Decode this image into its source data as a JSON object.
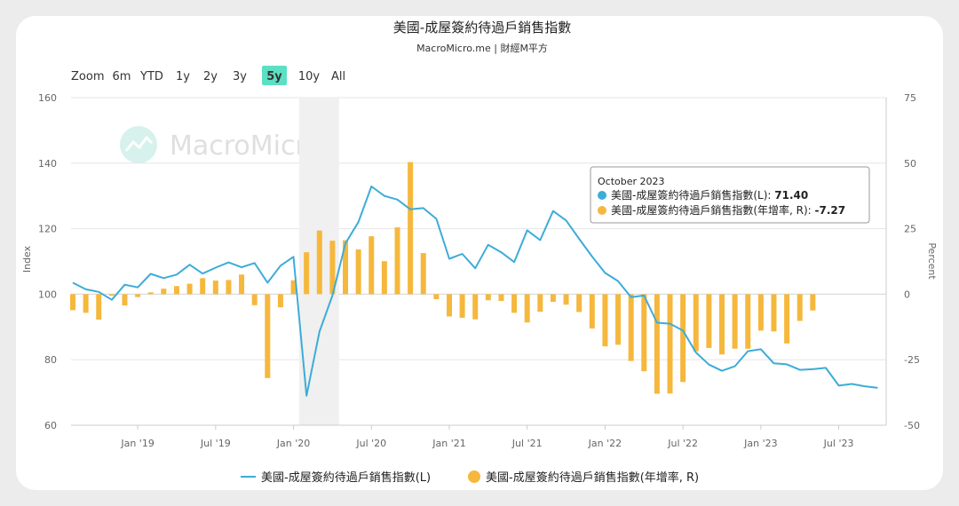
{
  "header": {
    "title": "美國-成屋簽約待過戶銷售指數",
    "subtitle": "MacroMicro.me | 財經M平方"
  },
  "zoom": {
    "label": "Zoom",
    "buttons": [
      "6m",
      "YTD",
      "1y",
      "2y",
      "3y",
      "5y",
      "10y",
      "All"
    ],
    "active": "5y"
  },
  "watermark": "MacroMicro",
  "legend": {
    "line_label": "美國-成屋簽約待過戶銷售指數(L)",
    "bar_label": "美國-成屋簽約待過戶銷售指數(年增率, R)"
  },
  "tooltip": {
    "date": "October 2023",
    "row1_label": "美國-成屋簽約待過戶銷售指數(L): ",
    "row1_value": "71.40",
    "row2_label": "美國-成屋簽約待過戶銷售指數(年增率, R): ",
    "row2_value": "-7.27"
  },
  "colors": {
    "line": "#3dacd8",
    "bar": "#f5b83d",
    "shade": "#f0f0f0",
    "active_button": "#5be0c4"
  },
  "chart_data": {
    "type": "line",
    "title": "美國-成屋簽約待過戶銷售指數",
    "subtitle": "MacroMicro.me | 財經M平方",
    "ylabel_left": "Index",
    "ylabel_right": "Percent",
    "y_left_range": [
      60,
      160
    ],
    "y_left_ticks": [
      60,
      80,
      100,
      120,
      140,
      160
    ],
    "y_right_range": [
      -50,
      75
    ],
    "y_right_ticks": [
      -50,
      -25,
      0,
      25,
      50,
      75
    ],
    "x_tick_labels": [
      "Jan '19",
      "Jul '19",
      "Jan '20",
      "Jul '20",
      "Jan '21",
      "Jul '21",
      "Jan '22",
      "Jul '22",
      "Jan '23",
      "Jul '23"
    ],
    "shaded_range": [
      "2020-02",
      "2020-04"
    ],
    "grid": true,
    "legend_position": "bottom",
    "months": [
      "2018-08",
      "2018-09",
      "2018-10",
      "2018-11",
      "2018-12",
      "2019-01",
      "2019-02",
      "2019-03",
      "2019-04",
      "2019-05",
      "2019-06",
      "2019-07",
      "2019-08",
      "2019-09",
      "2019-10",
      "2019-11",
      "2019-12",
      "2020-01",
      "2020-02",
      "2020-03",
      "2020-04",
      "2020-05",
      "2020-06",
      "2020-07",
      "2020-08",
      "2020-09",
      "2020-10",
      "2020-11",
      "2020-12",
      "2021-01",
      "2021-02",
      "2021-03",
      "2021-04",
      "2021-05",
      "2021-06",
      "2021-07",
      "2021-08",
      "2021-09",
      "2021-10",
      "2021-11",
      "2021-12",
      "2022-01",
      "2022-02",
      "2022-03",
      "2022-04",
      "2022-05",
      "2022-06",
      "2022-07",
      "2022-08",
      "2022-09",
      "2022-10",
      "2022-11",
      "2022-12",
      "2023-01",
      "2023-02",
      "2023-03",
      "2023-04",
      "2023-05",
      "2023-06",
      "2023-07",
      "2023-08",
      "2023-09",
      "2023-10"
    ],
    "series": [
      {
        "name": "美國-成屋簽約待過戶銷售指數(L)",
        "type": "line",
        "axis": "left",
        "values": [
          103.5,
          101.5,
          100.7,
          98.3,
          102.9,
          102.1,
          106.2,
          104.9,
          106.0,
          109.0,
          106.3,
          108.1,
          109.7,
          108.2,
          109.5,
          103.5,
          108.7,
          111.4,
          69.0,
          88.6,
          99.6,
          115.5,
          122.0,
          132.9,
          130.0,
          128.9,
          125.9,
          126.3,
          123.0,
          110.8,
          112.3,
          107.9,
          115.1,
          112.8,
          109.8,
          119.5,
          116.5,
          125.4,
          122.5,
          116.9,
          111.5,
          106.5,
          104.0,
          99.1,
          99.6,
          91.3,
          91.0,
          88.9,
          82.2,
          78.5,
          76.6,
          78.0,
          82.6,
          83.2,
          78.9,
          78.6,
          76.9,
          77.1,
          77.5,
          72.1,
          72.6,
          71.9,
          71.4
        ]
      },
      {
        "name": "美國-成屋簽約待過戶銷售指數(年增率, R)",
        "type": "bar",
        "axis": "right",
        "values": [
          -6.1,
          -7.1,
          -9.7,
          -0.6,
          -4.3,
          -1.1,
          0.7,
          2.1,
          3.1,
          4.0,
          6.1,
          5.2,
          5.4,
          7.5,
          -4.2,
          -32.0,
          -5.0,
          5.3,
          16.0,
          24.3,
          20.4,
          20.6,
          17.1,
          22.1,
          12.6,
          25.5,
          50.4,
          15.7,
          -1.9,
          -8.5,
          -9.0,
          -9.6,
          -2.3,
          -2.6,
          -7.1,
          -10.8,
          -6.7,
          -2.9,
          -4.0,
          -6.8,
          -13.1,
          -19.9,
          -19.3,
          -25.5,
          -29.4,
          -38.0,
          -37.9,
          -33.5,
          -21.8,
          -20.5,
          -23.0,
          -20.8,
          -20.8,
          -13.9,
          -14.2,
          -18.8,
          -10.2,
          -6.2
        ]
      }
    ]
  }
}
